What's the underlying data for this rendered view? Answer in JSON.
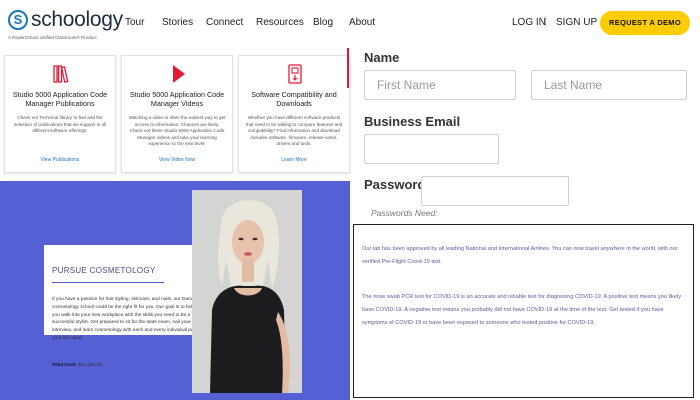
{
  "header": {
    "logo_mark": "S",
    "logo_word": "schoology",
    "logo_tagline": "A PowerSchool Unified Classroom® Product",
    "nav": [
      "Tour",
      "Stories",
      "Connect",
      "Resources",
      "Blog",
      "About"
    ],
    "login": "LOG IN",
    "separator": "|",
    "signup": "SIGN UP",
    "demo": "REQUEST A DEMO"
  },
  "cards": [
    {
      "icon": "books-icon",
      "title": "Studio 5000 Application Code Manager Publications",
      "desc": "Check out Technical library to find and the selection of publications that we support in all different software offerings.",
      "link": "View Publications"
    },
    {
      "icon": "play-icon",
      "title": "Studio 5000 Application Code Manager Videos",
      "desc": "Watching a video is often the easiest way to get access to information. Chances are likely. Check out these Studio 5000 Application Code Manager videos and take your learning experience to the next level.",
      "link": "View Video Now"
    },
    {
      "icon": "download-icon",
      "title": "Software Compatibility and Downloads",
      "desc": "Whether you have different software products that need to be talking to compare features and compatibility? Find information and download includes software, firmware, release notes, drivers and tools.",
      "link": "Learn More"
    }
  ],
  "cosmetology": {
    "title": "PURSUE COSMETOLOGY",
    "body": "If you have a passion for hair styling, skincare, and nails, our Danville cosmetology school could be the right fit for you. Our goal is to help you walk into your new workplace with the skills you need to be a successful stylist. Get prepared to sit for the state exam, nail your interview, and learn cosmetology with each and every individual part of your last week.",
    "cost_label": "Total Cost:",
    "cost_value": "$24,254.00"
  },
  "form": {
    "name_label": "Name",
    "first_placeholder": "First Name",
    "last_placeholder": "Last Name",
    "email_label": "Business Email",
    "password_label": "Password",
    "password_hint": "Passwords Need:"
  },
  "notice": {
    "p1": "Our lab has been approved by all leading National and International Airlines. You can now travel anywhere in the world, with our verified Pre-Flight Covid-19 test.",
    "p2": "The nose swab PCR test for COVID-19 is an accurate and reliable test for diagnosing COVID-19. A positive test means you likely have COVID-19. A negative test means you probably did not have COVID-19 at the time of the test. Get tested if you have symptoms of COVID-19 or have been exposed to someone who tested positive for COVID-19."
  },
  "colors": {
    "brand_blue": "#1b75bb",
    "accent_yellow": "#ffcc00",
    "accent_red": "#e31937",
    "section_blue": "#5460d4"
  }
}
